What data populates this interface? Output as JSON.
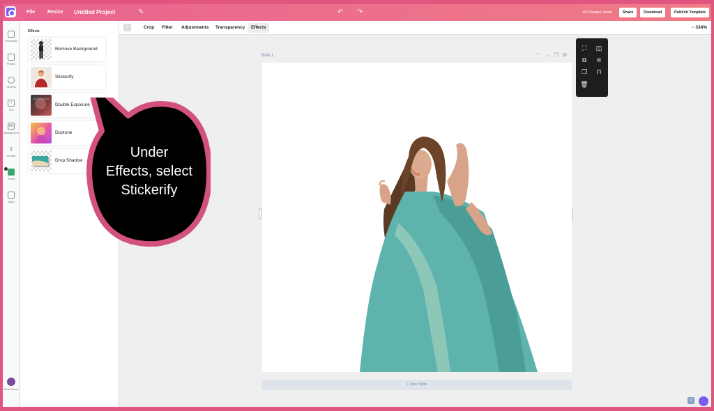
{
  "topbar": {
    "file": "File",
    "resize": "Resize",
    "project_name": "Untitled Project",
    "saved_status": "All Changes Saved",
    "share": "Share",
    "download": "Download",
    "publish": "Publish Template"
  },
  "rail": {
    "templates": "Templates",
    "photos": "Photos",
    "objects": "Objects",
    "text": "Text",
    "background": "Background",
    "upload": "Upload",
    "pixels": "Pixels",
    "apps": "Apps",
    "demo": "Book Demo",
    "bg_icon_text": "BG",
    "text_icon_text": "T"
  },
  "panel": {
    "title": "Effects",
    "effects": [
      {
        "label": "Remove Background"
      },
      {
        "label": "Stickerify"
      },
      {
        "label": "Double Exposure"
      },
      {
        "label": "Duotone"
      },
      {
        "label": "Drop Shadow"
      }
    ]
  },
  "subbar": {
    "tabs": [
      "Crop",
      "Filter",
      "Adjustments",
      "Transparency",
      "Effects"
    ],
    "active_tab": "Effects",
    "zoom": "334%"
  },
  "canvas": {
    "slide_label": "Slide 1",
    "new_slide": "+ New Slide"
  },
  "callout": {
    "text_line1": "Under",
    "text_line2": "Effects, select",
    "text_line3": "Stickerify"
  },
  "footer": {
    "page_badge": "1"
  },
  "colors": {
    "brand_pink": "#e0567f",
    "topbar_gradient_start": "#e9638e",
    "callout_border": "#d2527c",
    "saree_teal": "#5fb3ad"
  },
  "icons": {
    "undo": "undo-icon",
    "redo": "redo-icon",
    "zoom": "magnifier-icon"
  }
}
